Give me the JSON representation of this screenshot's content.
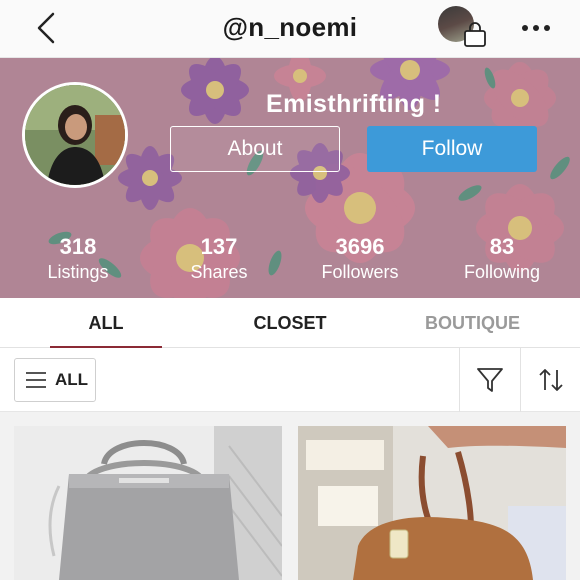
{
  "header": {
    "title": "@n_noemi",
    "back_icon": "chevron-left-icon",
    "bag_icon": "shopping-bag-icon",
    "more_icon": "more-horizontal-icon"
  },
  "profile": {
    "display_name": "Emisthrifting !",
    "about_label": "About",
    "follow_label": "Follow",
    "follow_color": "#3d9ad9"
  },
  "stats": [
    {
      "value": "318",
      "label": "Listings"
    },
    {
      "value": "137",
      "label": "Shares"
    },
    {
      "value": "3696",
      "label": "Followers"
    },
    {
      "value": "83",
      "label": "Following"
    }
  ],
  "tabs": [
    {
      "label": "ALL",
      "active": true
    },
    {
      "label": "CLOSET",
      "active": false
    },
    {
      "label": "BOUTIQUE",
      "active": false
    }
  ],
  "filter": {
    "all_label": "ALL",
    "menu_icon": "hamburger-icon",
    "filter_icon": "filter-funnel-icon",
    "sort_icon": "sort-arrows-icon"
  },
  "colors": {
    "active_tab_underline": "#8b2a35",
    "banner_base": "#b68c9a"
  }
}
